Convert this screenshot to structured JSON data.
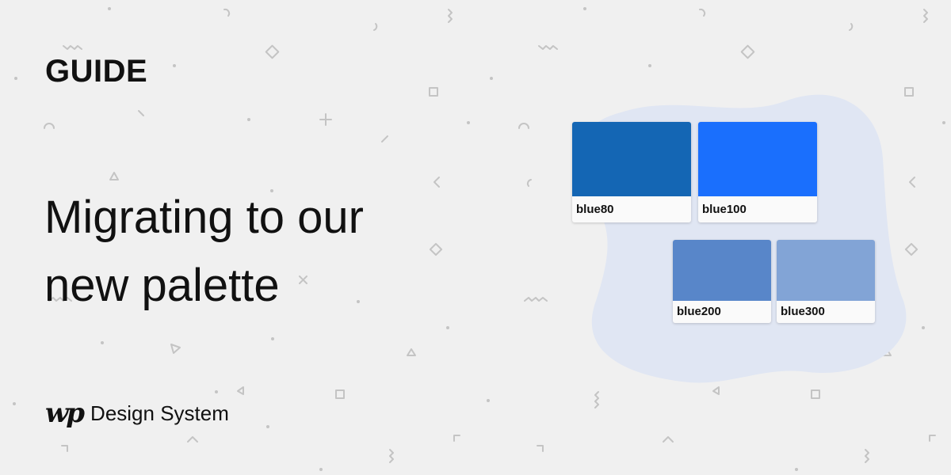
{
  "eyebrow": "GUIDE",
  "headline": {
    "line1": "Migrating to our",
    "line2": "new palette"
  },
  "brand": {
    "logo_text": "wp",
    "name": "Design System"
  },
  "colors": {
    "background": "#f0f0f0",
    "blob": "#e0e6f3",
    "decor": "#c4c4c4"
  },
  "swatches": [
    {
      "label": "blue80",
      "color": "#1466b4"
    },
    {
      "label": "blue100",
      "color": "#1a6ffd"
    },
    {
      "label": "blue200",
      "color": "#5886c9"
    },
    {
      "label": "blue300",
      "color": "#82a4d6"
    }
  ]
}
